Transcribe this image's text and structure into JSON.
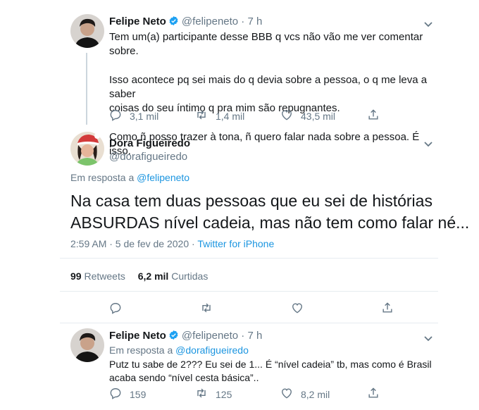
{
  "tweet1": {
    "name": "Felipe Neto",
    "handle": "@felipeneto",
    "sep": " · ",
    "time": "7 h",
    "line1": "Tem um(a) participante desse BBB q vcs não vão me ver comentar sobre.",
    "line2": "Isso acontece pq sei mais do q devia sobre a pessoa, o q me leva a saber",
    "line3": "coisas do seu íntimo q pra mim são repugnantes.",
    "line4": "Como ñ posso trazer à tona, ñ quero falar nada sobre a pessoa. É isso.",
    "replies": "3,1 mil",
    "retweets": "1,4 mil",
    "likes": "43,5 mil"
  },
  "main": {
    "name": "Dora Figueiredo",
    "handle": "@dorafigueiredo",
    "reply_prefix": "Em resposta a ",
    "reply_to": "@felipeneto",
    "text1": "Na casa tem duas pessoas que eu sei de histórias",
    "text2": "ABSURDAS nível cadeia, mas não tem como falar né...",
    "timestamp": "2:59 AM · 5 de fev de 2020 · ",
    "source": "Twitter for iPhone",
    "retweets_count": "99",
    "retweets_label": "Retweets",
    "likes_count": "6,2 mil",
    "likes_label": "Curtidas"
  },
  "tweet3": {
    "name": "Felipe Neto",
    "handle": "@felipeneto",
    "sep": " · ",
    "time": "7 h",
    "reply_prefix": "Em resposta a ",
    "reply_to": "@dorafigueiredo",
    "line1": "Putz tu sabe de 2??? Eu sei de 1... É “nível cadeia” tb, mas como é Brasil",
    "line2": "acaba sendo “nível cesta básica”..",
    "replies": "159",
    "retweets": "125",
    "likes": "8,2 mil"
  },
  "colors": {
    "verified": "#1da1f2",
    "link": "#1b95e0",
    "muted": "#657786",
    "thread_line": "#ccd6dd"
  },
  "icons": [
    "verified-badge-icon",
    "chevron-down-icon",
    "reply-icon",
    "retweet-icon",
    "like-icon",
    "share-icon"
  ]
}
